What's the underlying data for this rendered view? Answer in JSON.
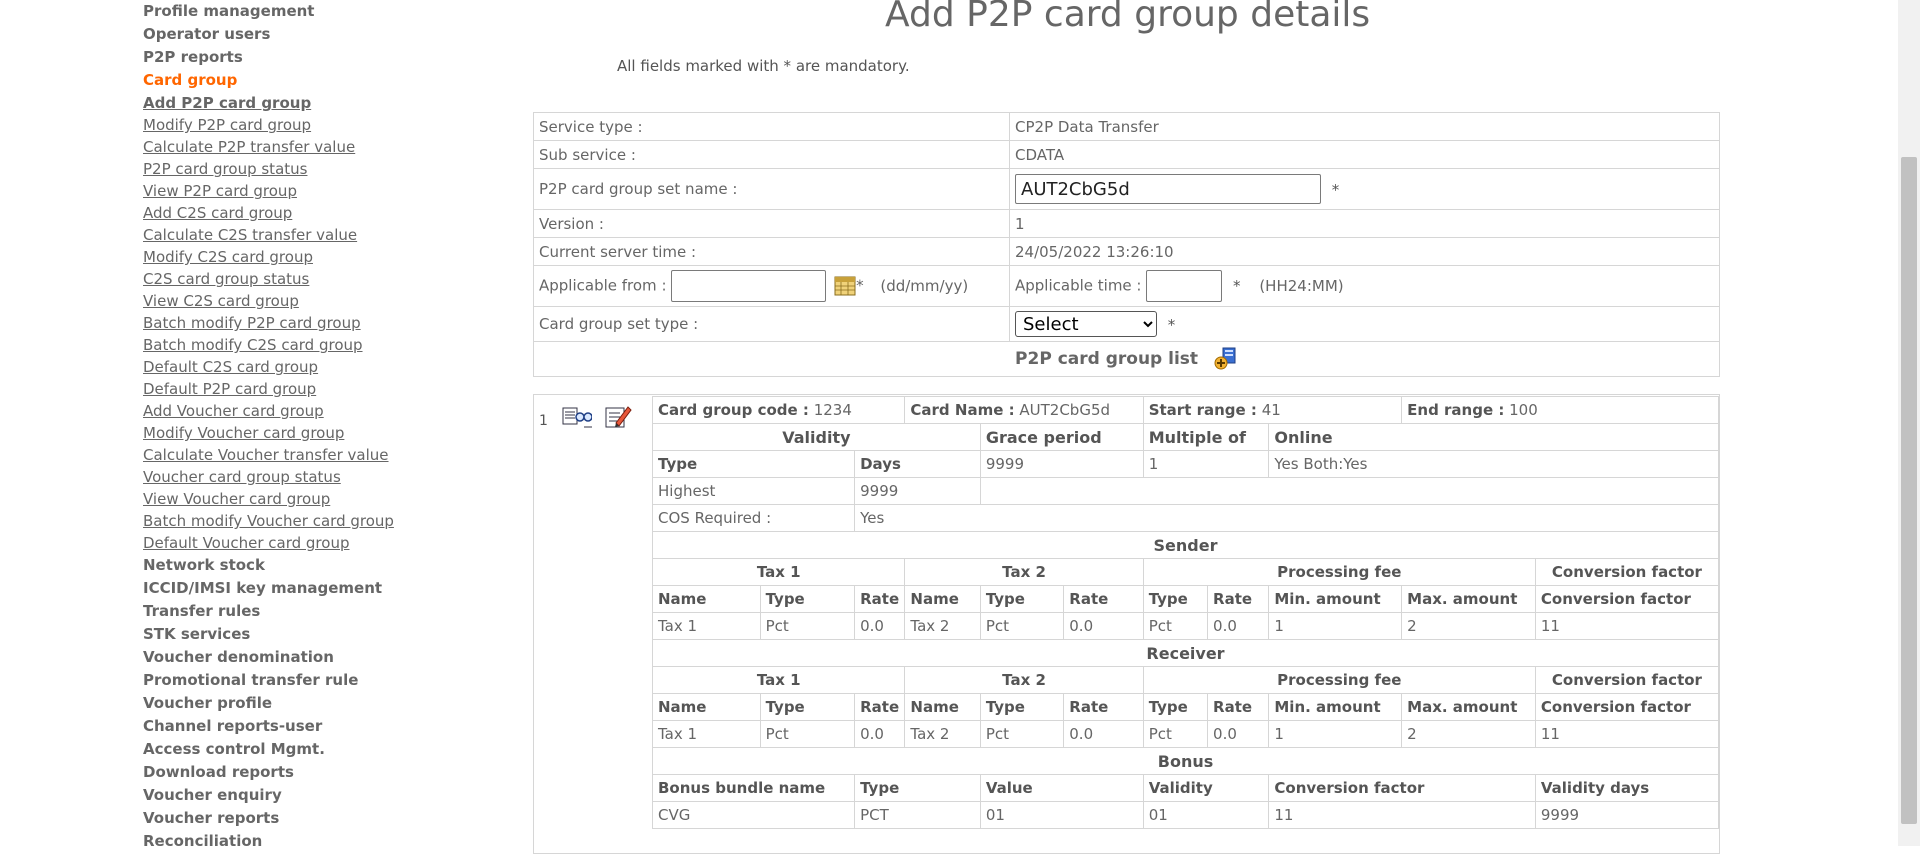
{
  "sidebar": {
    "top_items": [
      "Profile management",
      "Operator users",
      "P2P reports"
    ],
    "active_section": "Card group",
    "sub_items": [
      "Add P2P card group",
      "Modify P2P card group",
      "Calculate P2P transfer value",
      "P2P card group status",
      "View P2P card group",
      "Add C2S card group",
      "Calculate C2S transfer value",
      "Modify C2S card group",
      "C2S card group status",
      "View C2S card group",
      "Batch modify P2P card group",
      "Batch modify C2S card group",
      "Default C2S card group",
      "Default P2P card group",
      "Add Voucher card group",
      "Modify Voucher card group",
      "Calculate Voucher transfer value",
      "Voucher card group status",
      "View Voucher card group",
      "Batch modify Voucher card group",
      "Default Voucher card group"
    ],
    "bottom_items": [
      "Network stock",
      "ICCID/IMSI key management",
      "Transfer rules",
      "STK services",
      "Voucher denomination",
      "Promotional transfer rule",
      "Voucher profile",
      "Channel reports-user",
      "Access control Mgmt.",
      "Download reports",
      "Voucher enquiry",
      "Voucher reports",
      "Reconciliation"
    ]
  },
  "page": {
    "title": "Add P2P card group details",
    "mandatory_note": "All fields marked with * are mandatory."
  },
  "form": {
    "service_type_label": "Service type :",
    "service_type_value": "CP2P Data Transfer",
    "sub_service_label": "Sub service :",
    "sub_service_value": "CDATA",
    "set_name_label": "P2P card group set name :",
    "set_name_value": "AUT2CbG5d",
    "version_label": "Version :",
    "version_value": "1",
    "server_time_label": "Current server time :",
    "server_time_value": "24/05/2022 13:26:10",
    "applicable_from_label": "Applicable from :",
    "applicable_from_value": "",
    "date_format": "(dd/mm/yy)",
    "applicable_time_label": "Applicable time :",
    "applicable_time_value": "",
    "time_format": "(HH24:MM)",
    "set_type_label": "Card group set type :",
    "set_type_value": "Select",
    "star": "*",
    "list_header": "P2P card group list"
  },
  "card": {
    "index": "1",
    "code_label": "Card group code :",
    "code_value": "1234",
    "name_label": "Card Name :",
    "name_value": "AUT2CbG5d",
    "start_label": "Start range :",
    "start_value": "41",
    "end_label": "End range :",
    "end_value": "100",
    "validity_header": "Validity",
    "grace_header": "Grace period",
    "multiple_header": "Multiple of",
    "online_header": "Online",
    "type_label": "Type",
    "days_label": "Days",
    "grace_value": "9999",
    "multiple_value": "1",
    "online_value": "Yes Both:Yes",
    "validity_type": "Highest",
    "validity_days": "9999",
    "cos_label": "COS Required :",
    "cos_value": "Yes",
    "sender_header": "Sender",
    "receiver_header": "Receiver",
    "tax1_header": "Tax 1",
    "tax2_header": "Tax 2",
    "processing_header": "Processing fee",
    "conversion_header": "Conversion factor",
    "col_name": "Name",
    "col_type": "Type",
    "col_rate": "Rate",
    "col_min": "Min. amount",
    "col_max": "Max. amount",
    "col_conv": "Conversion factor",
    "sender_row": [
      "Tax 1",
      "Pct",
      "0.0",
      "Tax 2",
      "Pct",
      "0.0",
      "Pct",
      "0.0",
      "1",
      "2",
      "11"
    ],
    "receiver_row": [
      "Tax 1",
      "Pct",
      "0.0",
      "Tax 2",
      "Pct",
      "0.0",
      "Pct",
      "0.0",
      "1",
      "2",
      "11"
    ],
    "bonus_header": "Bonus",
    "bonus_cols": [
      "Bonus bundle name",
      "Type",
      "Value",
      "Validity",
      "Conversion factor",
      "Validity days"
    ],
    "bonus_row": [
      "CVG",
      "PCT",
      "01",
      "01",
      "11",
      "9999"
    ]
  },
  "colors": {
    "active_menu": "#ff6600",
    "border": "#d6d6d6",
    "text": "#666666"
  }
}
